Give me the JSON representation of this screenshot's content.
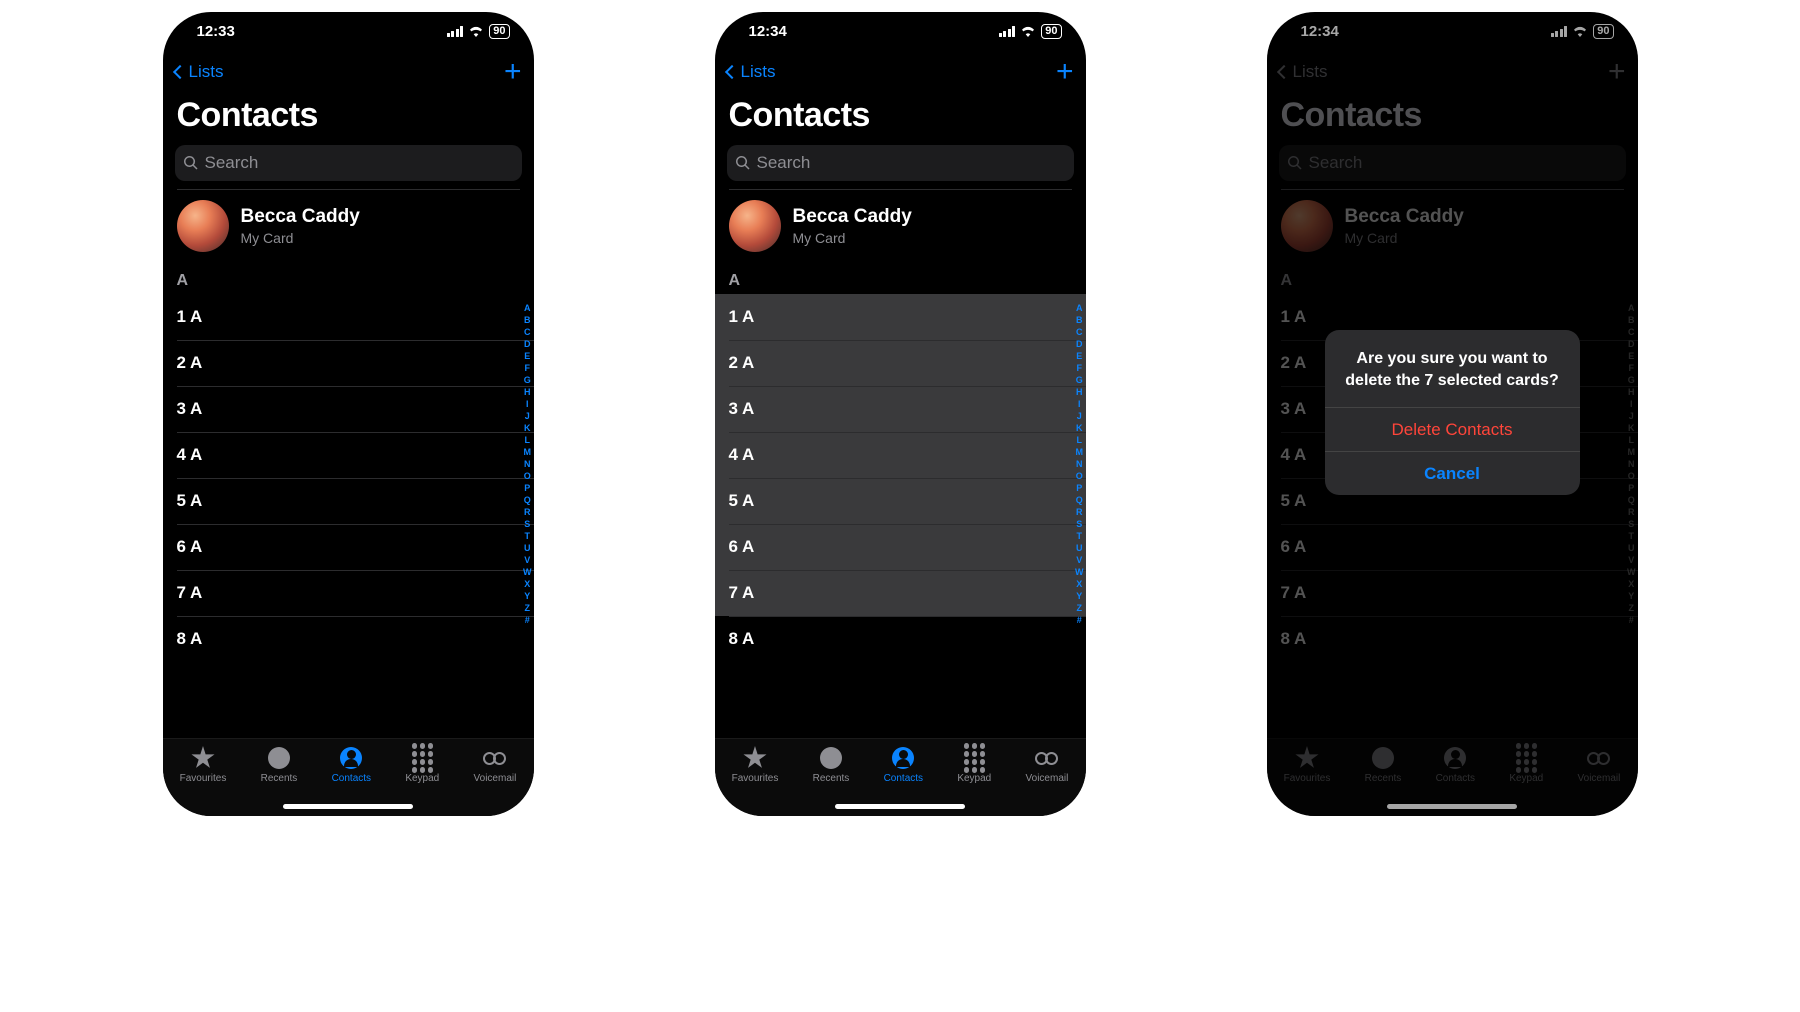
{
  "status_battery": "90",
  "index_letters": [
    "A",
    "B",
    "C",
    "D",
    "E",
    "F",
    "G",
    "H",
    "I",
    "J",
    "K",
    "L",
    "M",
    "N",
    "O",
    "P",
    "Q",
    "R",
    "S",
    "T",
    "U",
    "V",
    "W",
    "X",
    "Y",
    "Z",
    "#"
  ],
  "tabs": {
    "favourites": "Favourites",
    "recents": "Recents",
    "contacts": "Contacts",
    "keypad": "Keypad",
    "voicemail": "Voicemail"
  },
  "common": {
    "back_label": "Lists",
    "title": "Contacts",
    "search_placeholder": "Search",
    "mycard_name": "Becca Caddy",
    "mycard_sub": "My Card",
    "section": "A",
    "rows": [
      "1 A",
      "2 A",
      "3 A",
      "4 A",
      "5 A",
      "6 A",
      "7 A",
      "8 A"
    ]
  },
  "screens": [
    {
      "time": "12:33",
      "selected": false,
      "alert": null
    },
    {
      "time": "12:34",
      "selected": true,
      "alert": null
    },
    {
      "time": "12:34",
      "selected": false,
      "alert": {
        "message": "Are you sure you want to delete the 7 selected cards?",
        "delete": "Delete Contacts",
        "cancel": "Cancel"
      }
    }
  ]
}
